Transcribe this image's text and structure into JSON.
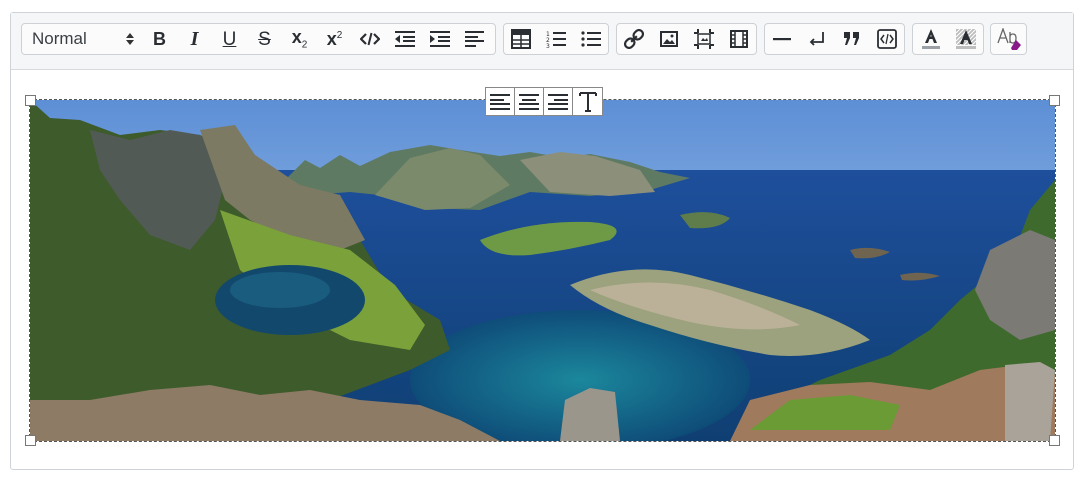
{
  "toolbar": {
    "format_select": {
      "value": "Normal"
    },
    "groups": [
      {
        "name": "text-formatting",
        "buttons": [
          "format-select",
          "bold",
          "italic",
          "underline",
          "strikethrough",
          "subscript",
          "superscript",
          "code",
          "outdent",
          "indent",
          "align"
        ]
      },
      {
        "name": "lists",
        "buttons": [
          "table",
          "ordered-list",
          "bullet-list"
        ]
      },
      {
        "name": "media",
        "buttons": [
          "link",
          "image",
          "image-resize",
          "video"
        ]
      },
      {
        "name": "blocks",
        "buttons": [
          "horizontal-rule",
          "line-break",
          "blockquote",
          "html-source"
        ]
      },
      {
        "name": "colors",
        "buttons": [
          "text-color",
          "background-color"
        ]
      },
      {
        "name": "clear",
        "buttons": [
          "clear-formatting"
        ]
      }
    ],
    "labels": {
      "bold": "B",
      "italic": "I",
      "underline": "U",
      "strike": "S",
      "sub_base": "x",
      "sub_index": "2",
      "sup_base": "x",
      "sup_index": "2"
    }
  },
  "image_toolbar": {
    "buttons": [
      "align-left",
      "align-center",
      "align-right",
      "text-wrap"
    ]
  },
  "image": {
    "subject": "coastal mountain panorama",
    "selected": true
  },
  "colors": {
    "toolbar_bg": "#f5f6f7",
    "border": "#cfd3d7",
    "icon": "#2a2e33",
    "clear_format_accent": "#8a1a8a"
  }
}
